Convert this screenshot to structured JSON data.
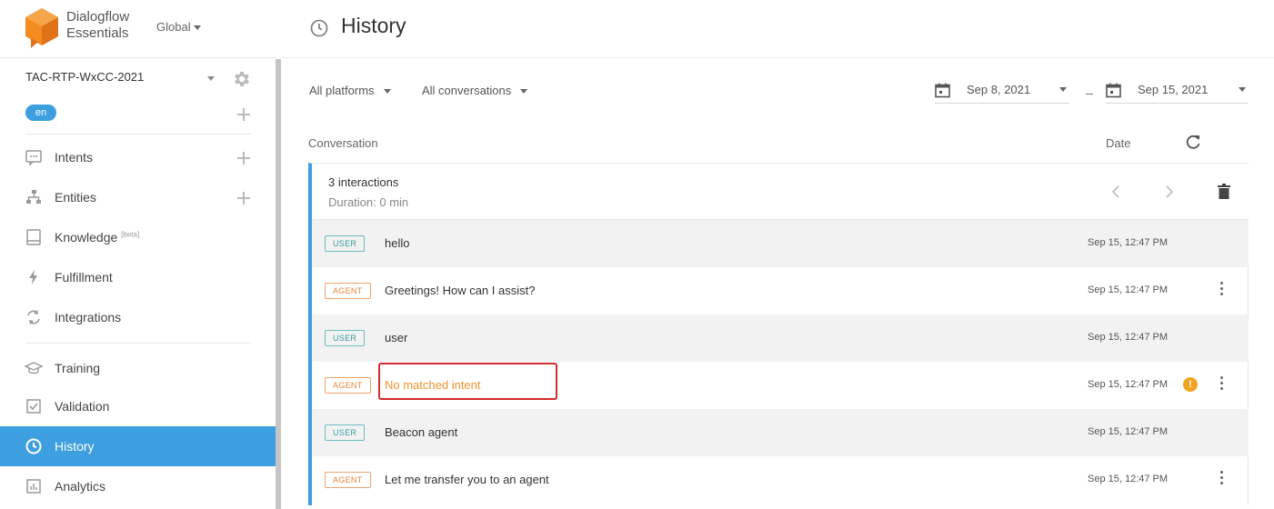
{
  "brand": {
    "line1": "Dialogflow",
    "line2": "Essentials",
    "region": "Global",
    "logo_color": "#f58c1f"
  },
  "agent": {
    "name": "TAC-RTP-WxCC-2021",
    "language": "en"
  },
  "nav": [
    {
      "label": "Intents",
      "icon": "chat-bubble-icon",
      "has_add": true
    },
    {
      "label": "Entities",
      "icon": "hierarchy-icon",
      "has_add": true
    },
    {
      "label": "Knowledge",
      "badge": "[beta]",
      "icon": "book-icon"
    },
    {
      "label": "Fulfillment",
      "icon": "lightning-icon"
    },
    {
      "label": "Integrations",
      "icon": "sync-icon"
    },
    {
      "label": "Training",
      "icon": "graduation-cap-icon"
    },
    {
      "label": "Validation",
      "icon": "check-square-icon"
    },
    {
      "label": "History",
      "icon": "history-icon",
      "active": true
    },
    {
      "label": "Analytics",
      "icon": "bar-chart-icon"
    }
  ],
  "header": {
    "title": "History"
  },
  "filters": {
    "platform": "All platforms",
    "conversations": "All conversations",
    "date_from": "Sep 8, 2021",
    "date_to": "Sep 15, 2021",
    "range_separator": "–"
  },
  "table": {
    "col_conversation": "Conversation",
    "col_date": "Date"
  },
  "conversation": {
    "count": "3 interactions",
    "duration": "Duration: 0 min",
    "rows": [
      {
        "role": "USER",
        "text": "hello",
        "time": "Sep 15, 12:47 PM"
      },
      {
        "role": "AGENT",
        "text": "Greetings! How can I assist?",
        "time": "Sep 15, 12:47 PM"
      },
      {
        "role": "USER",
        "text": "user",
        "time": "Sep 15, 12:47 PM"
      },
      {
        "role": "AGENT",
        "text": "No matched intent",
        "time": "Sep 15, 12:47 PM",
        "warning": "!"
      },
      {
        "role": "USER",
        "text": "Beacon agent",
        "time": "Sep 15, 12:47 PM"
      },
      {
        "role": "AGENT",
        "text": "Let me transfer you to an agent",
        "time": "Sep 15, 12:47 PM"
      }
    ]
  },
  "colors": {
    "accent": "#3d9fe0",
    "user_tag": "#3a9aa3",
    "agent_tag": "#e8853a",
    "warning": "#f0a421",
    "highlight": "#d6282b"
  }
}
